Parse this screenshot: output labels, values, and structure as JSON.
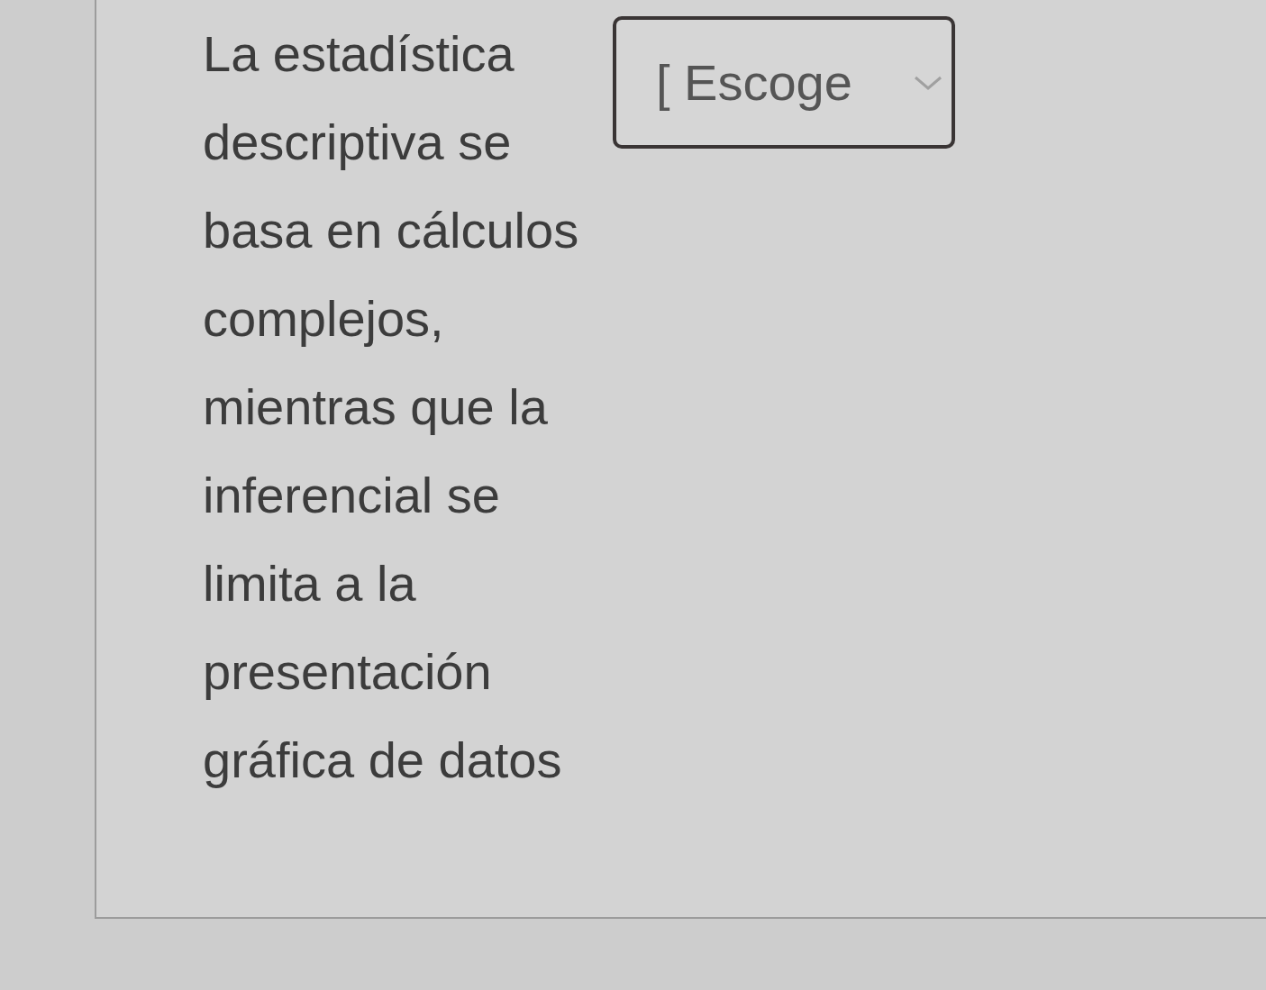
{
  "question": {
    "statement": "La estadística descriptiva se basa en cálculos complejos, mientras que la inferencial se limita a la presentación gráfica de datos",
    "dropdown": {
      "placeholder": "[ Escoge"
    }
  }
}
